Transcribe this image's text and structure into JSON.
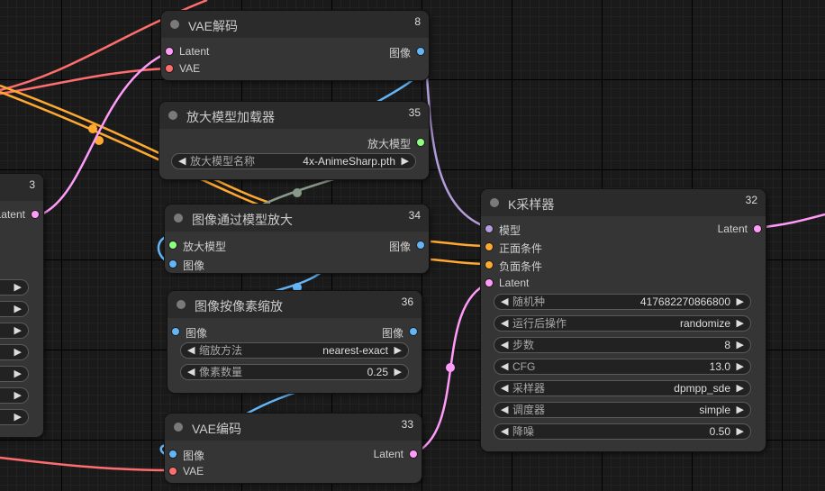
{
  "colors": {
    "latent": "#ff9cf9",
    "vae": "#ff6e6e",
    "image": "#64b5f6",
    "upscale_model": "#8eff81",
    "model": "#b39ddb",
    "conditioning": "#ffa931",
    "link_gray": "#8a9a8a"
  },
  "partial_node": {
    "id": "3",
    "output_label": "Latent"
  },
  "vae_decode": {
    "title": "VAE解码",
    "id": "8",
    "inputs": [
      "Latent",
      "VAE"
    ],
    "outputs": [
      "图像"
    ]
  },
  "upscale_loader": {
    "title": "放大模型加载器",
    "id": "35",
    "outputs": [
      "放大模型"
    ],
    "widget": {
      "label": "放大模型名称",
      "value": "4x-AnimeSharp.pth"
    }
  },
  "image_upscale": {
    "title": "图像通过模型放大",
    "id": "34",
    "inputs": [
      "放大模型",
      "图像"
    ],
    "outputs": [
      "图像"
    ]
  },
  "image_scale": {
    "title": "图像按像素缩放",
    "id": "36",
    "inputs": [
      "图像"
    ],
    "outputs": [
      "图像"
    ],
    "widgets": [
      {
        "label": "缩放方法",
        "value": "nearest-exact"
      },
      {
        "label": "像素数量",
        "value": "0.25"
      }
    ]
  },
  "vae_encode": {
    "title": "VAE编码",
    "id": "33",
    "inputs": [
      "图像",
      "VAE"
    ],
    "outputs": [
      "Latent"
    ]
  },
  "ksampler": {
    "title": "K采样器",
    "id": "32",
    "inputs": [
      "模型",
      "正面条件",
      "负面条件",
      "Latent"
    ],
    "outputs": [
      "Latent"
    ],
    "widgets": [
      {
        "label": "随机种",
        "value": "417682270866800"
      },
      {
        "label": "运行后操作",
        "value": "randomize"
      },
      {
        "label": "步数",
        "value": "8"
      },
      {
        "label": "CFG",
        "value": "13.0"
      },
      {
        "label": "采样器",
        "value": "dpmpp_sde"
      },
      {
        "label": "调度器",
        "value": "simple"
      },
      {
        "label": "降噪",
        "value": "0.50"
      }
    ]
  }
}
